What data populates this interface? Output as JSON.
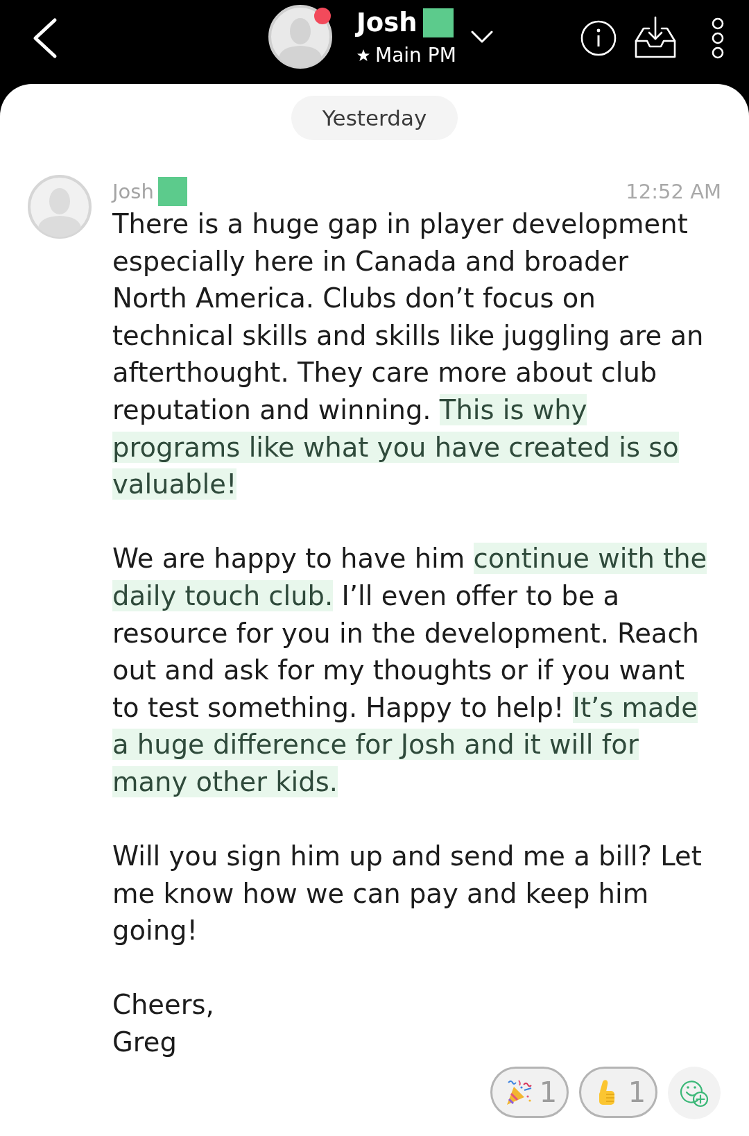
{
  "header": {
    "title": "Josh",
    "subtitle": "Main PM",
    "notification": true
  },
  "date_divider": "Yesterday",
  "message": {
    "sender": "Josh",
    "time": "12:52 AM",
    "paragraphs": [
      {
        "segments": [
          {
            "text": "There is a huge gap in player development especially here in Canada and broader North America. Clubs don’t focus on technical skills and skills like juggling are an afterthought. They care more about club reputation and winning. ",
            "highlighted": false
          },
          {
            "text": "This is why programs like what you have created is so valuable!",
            "highlighted": true
          }
        ]
      },
      {
        "segments": [
          {
            "text": "We are happy to have him ",
            "highlighted": false
          },
          {
            "text": "continue with the daily touch club.",
            "highlighted": true
          },
          {
            "text": " I’ll even offer to be a resource for you in the development. Reach out and ask for my thoughts or if you want to test something. Happy to help! ",
            "highlighted": false
          },
          {
            "text": "It’s made a huge difference for Josh and it will for many other kids.",
            "highlighted": true
          }
        ]
      },
      {
        "segments": [
          {
            "text": "Will you sign him up and send me a bill? Let me know how we can pay and keep him going!",
            "highlighted": false
          }
        ]
      },
      {
        "segments": [
          {
            "text": "Cheers,\nGreg",
            "highlighted": false
          }
        ]
      }
    ],
    "reactions": [
      {
        "kind": "party_popper",
        "count": "1",
        "selected": false
      },
      {
        "kind": "thumbs_up",
        "count": "1",
        "selected": false
      }
    ]
  }
}
